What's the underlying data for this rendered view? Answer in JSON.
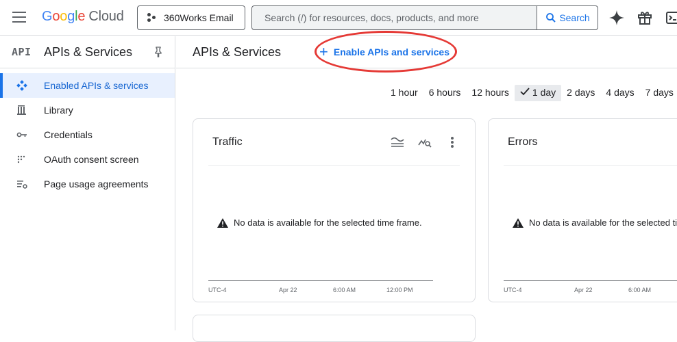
{
  "header": {
    "logo_google": [
      "G",
      "o",
      "o",
      "g",
      "l",
      "e"
    ],
    "logo_cloud": "Cloud",
    "project_label": "360Works Email",
    "search_placeholder": "Search (/) for resources, docs, products, and more",
    "search_button": "Search"
  },
  "sidebar": {
    "badge": "API",
    "title": "APIs & Services",
    "items": [
      {
        "label": "Enabled APIs & services",
        "icon": "dashboard-diamond-icon",
        "active": true
      },
      {
        "label": "Library",
        "icon": "library-icon",
        "active": false
      },
      {
        "label": "Credentials",
        "icon": "key-icon",
        "active": false
      },
      {
        "label": "OAuth consent screen",
        "icon": "oauth-icon",
        "active": false
      },
      {
        "label": "Page usage agreements",
        "icon": "settings-list-icon",
        "active": false
      }
    ]
  },
  "main": {
    "title": "APIs & Services",
    "enable_button": "Enable APIs and services",
    "time_ranges": [
      "1 hour",
      "6 hours",
      "12 hours",
      "1 day",
      "2 days",
      "4 days",
      "7 days"
    ],
    "selected_range": "1 day",
    "cards": [
      {
        "title": "Traffic",
        "nodata": "No data is available for the selected time frame.",
        "ticks": [
          "UTC-4",
          "Apr 22",
          "6:00 AM",
          "12:00 PM"
        ]
      },
      {
        "title": "Errors",
        "nodata": "No data is available for the selected time frame.",
        "ticks": [
          "UTC-4",
          "Apr 22",
          "6:00 AM"
        ]
      }
    ]
  },
  "colors": {
    "accent": "#1a73e8",
    "highlight": "#e53935",
    "active_bg": "#e8f0fe"
  }
}
